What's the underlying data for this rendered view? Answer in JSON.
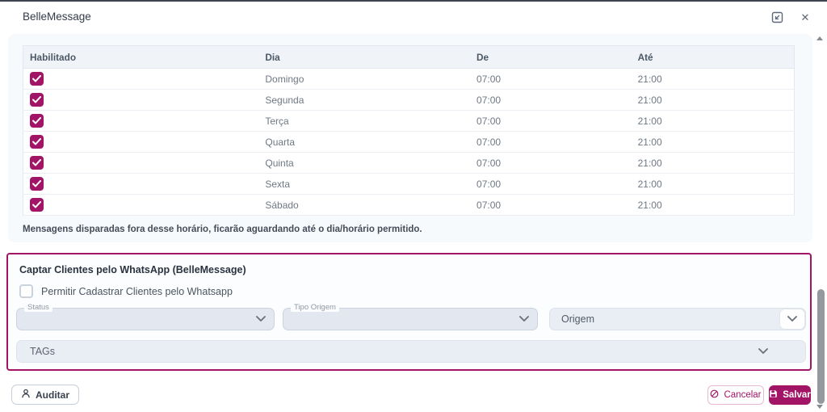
{
  "modal": {
    "title": "BelleMessage",
    "close_glyph": "✕"
  },
  "schedule_table": {
    "headers": [
      "Habilitado",
      "Dia",
      "De",
      "Até"
    ],
    "rows": [
      {
        "enabled": true,
        "day": "Domingo",
        "from": "07:00",
        "to": "21:00"
      },
      {
        "enabled": true,
        "day": "Segunda",
        "from": "07:00",
        "to": "21:00"
      },
      {
        "enabled": true,
        "day": "Terça",
        "from": "07:00",
        "to": "21:00"
      },
      {
        "enabled": true,
        "day": "Quarta",
        "from": "07:00",
        "to": "21:00"
      },
      {
        "enabled": true,
        "day": "Quinta",
        "from": "07:00",
        "to": "21:00"
      },
      {
        "enabled": true,
        "day": "Sexta",
        "from": "07:00",
        "to": "21:00"
      },
      {
        "enabled": true,
        "day": "Sábado",
        "from": "07:00",
        "to": "21:00"
      }
    ],
    "note": "Mensagens disparadas fora desse horário, ficarão aguardando até o dia/horário permitido."
  },
  "capture_section": {
    "title": "Captar Clientes pelo WhatsApp (BelleMessage)",
    "allow_checkbox": {
      "label": "Permitir Cadastrar Clientes pelo Whatsapp",
      "checked": false
    },
    "status_select": {
      "label": "Status",
      "value": ""
    },
    "tipo_origem_select": {
      "label": "Tipo Origem",
      "value": ""
    },
    "origem_select": {
      "placeholder": "Origem"
    },
    "tags_select": {
      "placeholder": "TAGs"
    }
  },
  "footer": {
    "audit_label": "Auditar",
    "cancel_label": "Cancelar",
    "save_label": "Salvar"
  },
  "icons": {
    "window": [
      "expand-icon",
      "close-icon"
    ],
    "audit": "user-icon",
    "cancel": "ban-icon",
    "save": "floppy-disk-icon",
    "selects": "chevron-down-icon",
    "checkbox": "check-icon"
  },
  "colors": {
    "accent": "#A21566",
    "panel_bg": "#F7FAFC",
    "header_row_bg": "#F0F4F9",
    "disabled_field_bg": "#E3E8F0",
    "field_bg": "#E9EEF4"
  }
}
